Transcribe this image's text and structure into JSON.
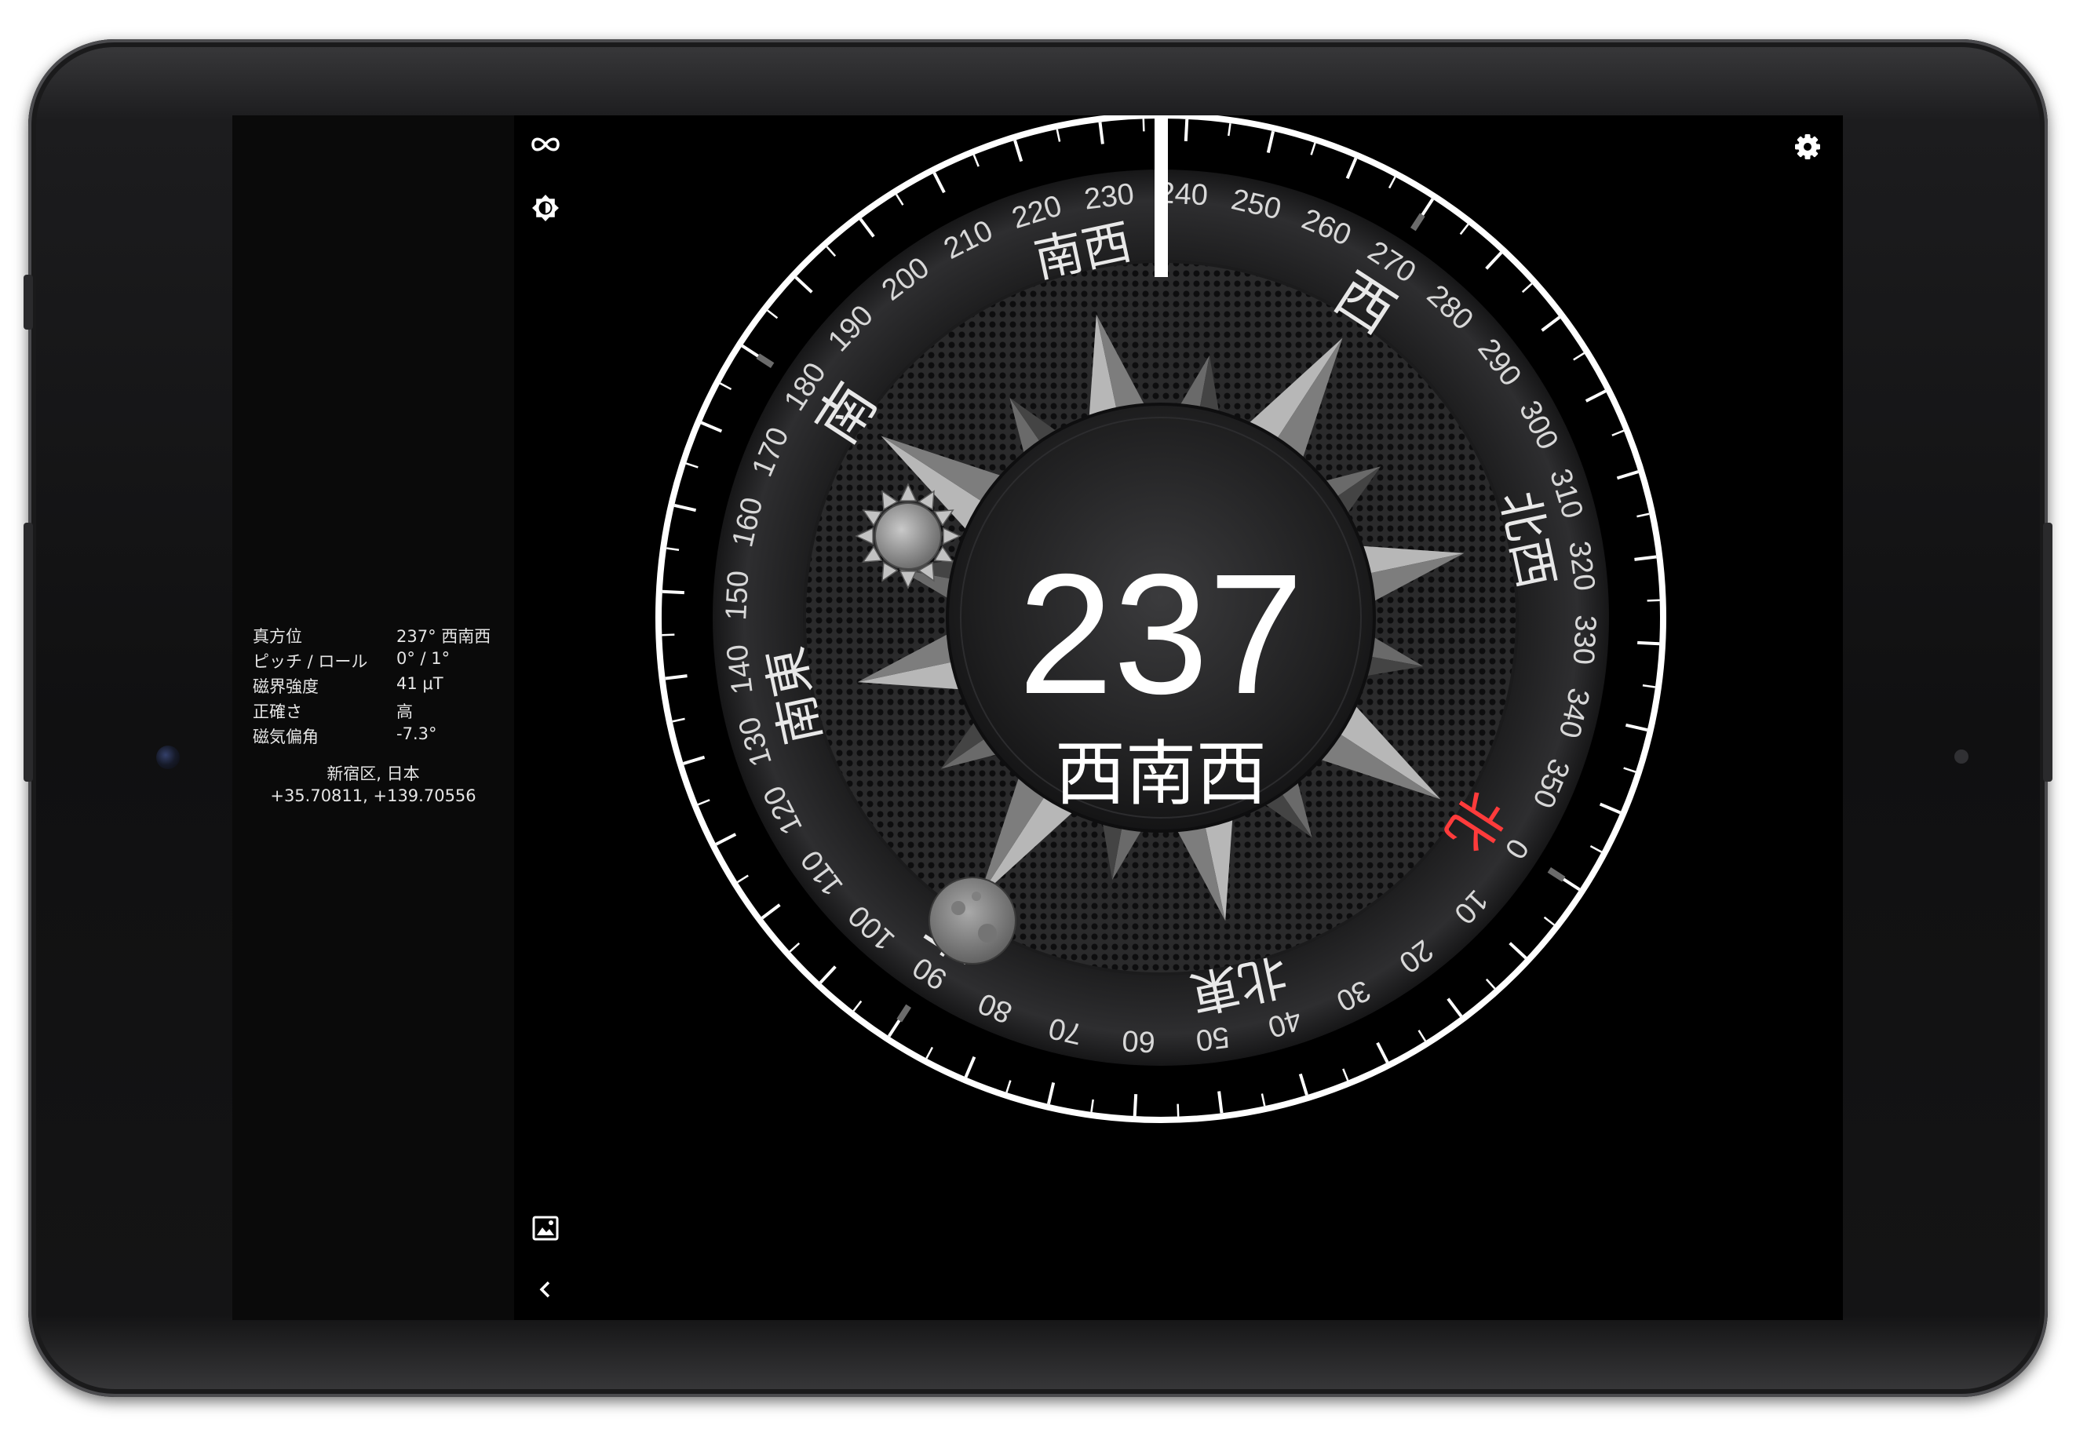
{
  "info": {
    "rows": [
      {
        "label": "真方位",
        "value": "237° 西南西"
      },
      {
        "label": "ピッチ / ロール",
        "value": "0° / 1°"
      },
      {
        "label": "磁界強度",
        "value": "41 μT"
      },
      {
        "label": "正確さ",
        "value": "高"
      },
      {
        "label": "磁気偏角",
        "value": "-7.3°"
      }
    ],
    "location_name": "新宿区, 日本",
    "coordinates": "+35.70811, +139.70556"
  },
  "compass": {
    "heading": 237,
    "heading_text": "237",
    "heading_direction": "西南西",
    "degree_labels": [
      "0",
      "10",
      "20",
      "30",
      "40",
      "50",
      "60",
      "70",
      "80",
      "90",
      "100",
      "110",
      "120",
      "130",
      "140",
      "150",
      "160",
      "170",
      "180",
      "190",
      "200",
      "210",
      "220",
      "230",
      "240",
      "250",
      "260",
      "270",
      "280",
      "290",
      "300",
      "310",
      "320",
      "330",
      "340",
      "350"
    ],
    "cardinals": [
      {
        "label": "北",
        "deg": 0,
        "color": "#ff3b3b"
      },
      {
        "label": "北東",
        "deg": 45,
        "color": "#e8e8e8"
      },
      {
        "label": "東",
        "deg": 90,
        "color": "#e8e8e8"
      },
      {
        "label": "南東",
        "deg": 135,
        "color": "#e8e8e8"
      },
      {
        "label": "南",
        "deg": 180,
        "color": "#e8e8e8"
      },
      {
        "label": "南西",
        "deg": 225,
        "color": "#e8e8e8"
      },
      {
        "label": "西",
        "deg": 270,
        "color": "#e8e8e8"
      },
      {
        "label": "北西",
        "deg": 315,
        "color": "#e8e8e8"
      }
    ],
    "sun_icon": "sun-icon",
    "moon_icon": "moon-icon"
  },
  "toolbar": {
    "infinity_icon": "infinity-icon",
    "brightness_icon": "brightness-icon",
    "gallery_icon": "image-icon",
    "back_icon": "chevron-left-icon",
    "settings_icon": "gear-icon"
  }
}
